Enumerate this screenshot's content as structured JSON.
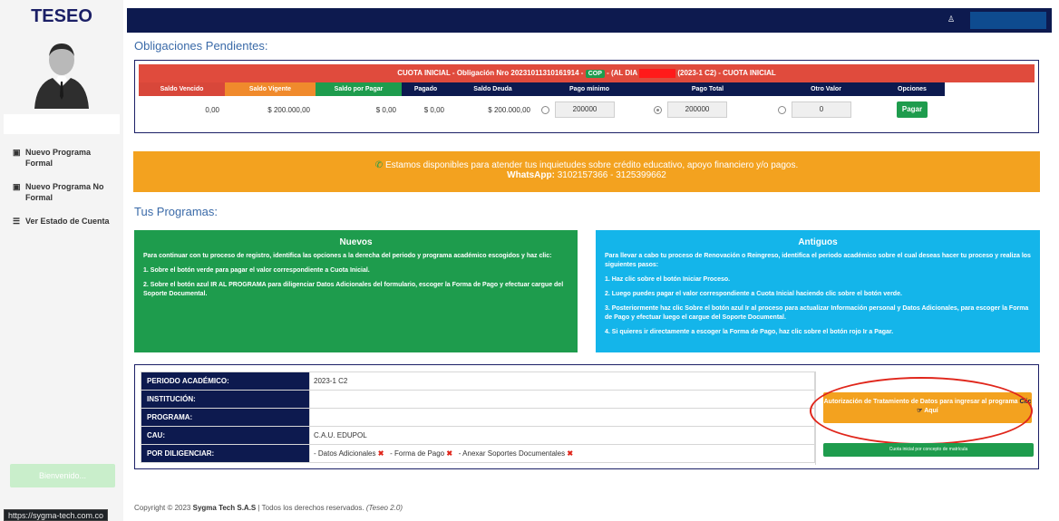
{
  "app": {
    "brand": "TESEO"
  },
  "sidebar": {
    "items": [
      {
        "icon": "plus-box-icon",
        "label": "Nuevo Programa Formal"
      },
      {
        "icon": "plus-box-icon",
        "label": "Nuevo Programa No Formal"
      },
      {
        "icon": "list-icon",
        "label": "Ver Estado de Cuenta"
      }
    ],
    "welcome": "Bienvenido...",
    "status_url": "https://sygma-tech.com.co"
  },
  "obligations": {
    "title": "Obligaciones Pendientes:",
    "header": {
      "prefix": "CUOTA INICIAL - Obligación Nro 20231011310161914 -",
      "currency": "COP",
      "mid": "- (AL DIA",
      "suffix": "(2023-1 C2) - CUOTA INICIAL"
    },
    "columns": [
      "Saldo Vencido",
      "Saldo Vigente",
      "Saldo por Pagar",
      "Pagado",
      "Saldo Deuda",
      "Pago mínimo",
      "Pago Total",
      "Otro Valor",
      "Opciones"
    ],
    "row": {
      "saldo_vencido": "0,00",
      "saldo_vigente": "$ 200.000,00",
      "saldo_por_pagar": "$ 0,00",
      "pagado": "$ 0,00",
      "saldo_deuda": "$ 200.000,00",
      "pago_minimo": "200000",
      "pago_total": "200000",
      "otro_valor": "0",
      "selected_option": "pago_total",
      "pay_label": "Pagar"
    }
  },
  "banner": {
    "text": "Estamos disponibles para atender tus inquietudes sobre crédito educativo, apoyo financiero y/o pagos.",
    "whatsapp_label": "WhatsApp:",
    "whatsapp_numbers": "3102157366 - 3125399662"
  },
  "programs": {
    "title": "Tus Programas:",
    "nuevos": {
      "heading": "Nuevos",
      "intro": "Para continuar con tu proceso de registro, identifica las opciones a la derecha del periodo y programa académico escogidos y haz clic:",
      "step1": "1. Sobre el botón verde para pagar el valor correspondiente a Cuota Inicial.",
      "step2": "2. Sobre el botón azul IR AL PROGRAMA para diligenciar Datos Adicionales del formulario, escoger la Forma de Pago y efectuar cargue del Soporte Documental."
    },
    "antiguos": {
      "heading": "Antiguos",
      "intro": "Para llevar a cabo tu proceso de Renovación o Reingreso, identifica el periodo académico sobre el cual deseas hacer tu proceso y realiza los siguientes pasos:",
      "step1": "1. Haz clic sobre el botón Iniciar Proceso.",
      "step2": "2. Luego puedes pagar el valor correspondiente a Cuota Inicial haciendo clic sobre el botón verde.",
      "step3": "3. Posteriormente haz clic Sobre el botón azul Ir al proceso para actualizar Información personal y Datos Adicionales, para escoger la Forma de Pago y efectuar luego el cargue del Soporte Documental.",
      "step4": "4. Si quieres ir directamente a escoger la Forma de Pago, haz clic sobre el botón rojo Ir a Pagar."
    }
  },
  "program_detail": {
    "periodo_label": "PERIODO ACADÉMICO:",
    "periodo_value": "2023-1 C2",
    "institucion_label": "INSTITUCIÓN:",
    "programa_label": "PROGRAMA:",
    "cau_label": "CAU:",
    "cau_value": "C.A.U. EDUPOL",
    "por_diligenciar_label": "POR DILIGENCIAR:",
    "pending": [
      "- Datos Adicionales",
      "- Forma de Pago",
      "- Anexar Soportes Documentales"
    ],
    "auth_button_text": "Autorización de Tratamiento de Datos para ingresar al programa",
    "auth_button_clic": "Clic",
    "auth_button_aqui": "Aquí",
    "cuota_button": "Cuota inicial por concepto de matrícula"
  },
  "footer": {
    "prefix": "Copyright © 2023",
    "company": "Sygma Tech S.A.S",
    "suffix": "| Todos los derechos reservados.",
    "version": "(Teseo 2.0)"
  },
  "colors": {
    "navy": "#0d1a4f",
    "green": "#1e9c4d",
    "orange": "#f3a21f",
    "red": "#e04b3d",
    "light_blue": "#14b5ea"
  }
}
